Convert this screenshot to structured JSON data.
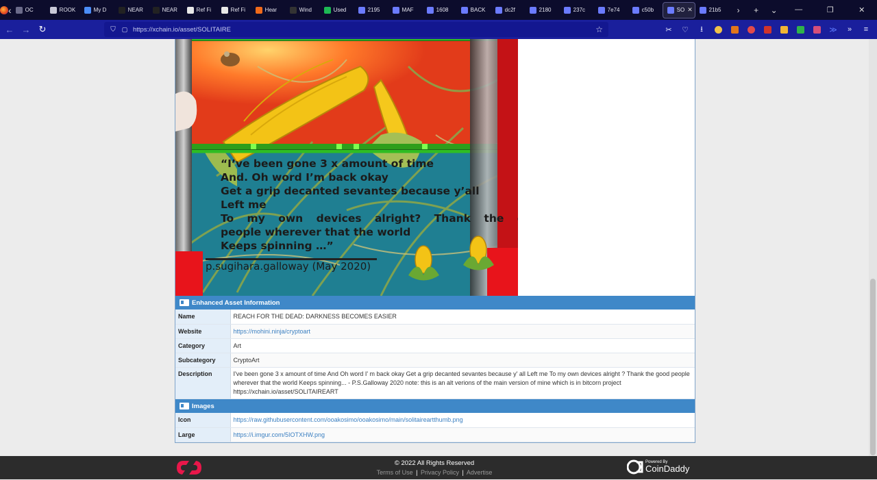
{
  "browser": {
    "tabs": [
      {
        "label": "OC",
        "color": "#6b6b8a"
      },
      {
        "label": "ROOK",
        "color": "#c9c9d8"
      },
      {
        "label": "My D",
        "color": "#4b8df8"
      },
      {
        "label": "NEAR",
        "color": "#222"
      },
      {
        "label": "NEAR",
        "color": "#222"
      },
      {
        "label": "Ref Fi",
        "color": "#e8e8e8"
      },
      {
        "label": "Ref Fi",
        "color": "#e8e8e8"
      },
      {
        "label": "Hear",
        "color": "#f06a1a"
      },
      {
        "label": "Wind",
        "color": "#333"
      },
      {
        "label": "Used",
        "color": "#1db954"
      },
      {
        "label": "2195",
        "color": "#6b7bff"
      },
      {
        "label": "MAF",
        "color": "#6b7bff"
      },
      {
        "label": "1608",
        "color": "#6b7bff"
      },
      {
        "label": "BACK",
        "color": "#6b7bff"
      },
      {
        "label": "dc2f",
        "color": "#6b7bff"
      },
      {
        "label": "2180",
        "color": "#6b7bff"
      },
      {
        "label": "237c",
        "color": "#6b7bff"
      },
      {
        "label": "7e74",
        "color": "#6b7bff"
      },
      {
        "label": "c50b",
        "color": "#6b7bff"
      },
      {
        "label": "SO",
        "color": "#6b7bff",
        "active": true
      },
      {
        "label": "21b5",
        "color": "#6b7bff"
      }
    ],
    "url": "https://xchain.io/asset/SOLITAIRE"
  },
  "artwork": {
    "poem_lines": [
      "“I’ve been gone 3 x amount of time",
      "And. Oh word I’m back okay",
      "Get a grip decanted sevantes because y’all",
      "Left me",
      "To my own devices alright? Thank the good",
      "people wherever that the world",
      "Keeps spinning …”"
    ],
    "signature": "p.sugihara.galloway (May 2020)"
  },
  "enhanced": {
    "heading": "Enhanced Asset Information",
    "rows": [
      {
        "key": "Name",
        "value": "REACH FOR THE DEAD: DARKNESS BECOMES EASIER"
      },
      {
        "key": "Website",
        "value": "https://mohini.ninja/cryptoart"
      },
      {
        "key": "Category",
        "value": "Art"
      },
      {
        "key": "Subcategory",
        "value": "CryptoArt"
      },
      {
        "key": "Description",
        "value": "I've been gone 3 x amount of time And Oh word I' m back okay Get a grip decanted sevantes because y' all Left me To my own devices alright ? Thank the good people wherever that the world Keeps spinning... - P.S.Galloway 2020 note: this is an alt verions of the main version of mine which is in bitcorn project https://xchain.io/asset/SOLITAIREART"
      }
    ]
  },
  "images": {
    "heading": "Images",
    "rows": [
      {
        "key": "Icon",
        "value": "https://raw.githubusercontent.com/ooakosimo/ooakosimo/main/solitaireartthumb.png"
      },
      {
        "key": "Large",
        "value": "https://i.imgur.com/5IOTXHW.png"
      }
    ]
  },
  "footer": {
    "copyright": "© 2022 All Rights Reserved",
    "links": [
      "Terms of Use",
      "Privacy Policy",
      "Advertise"
    ],
    "powered_by": "Powered By",
    "brand": "CoinDaddy"
  }
}
